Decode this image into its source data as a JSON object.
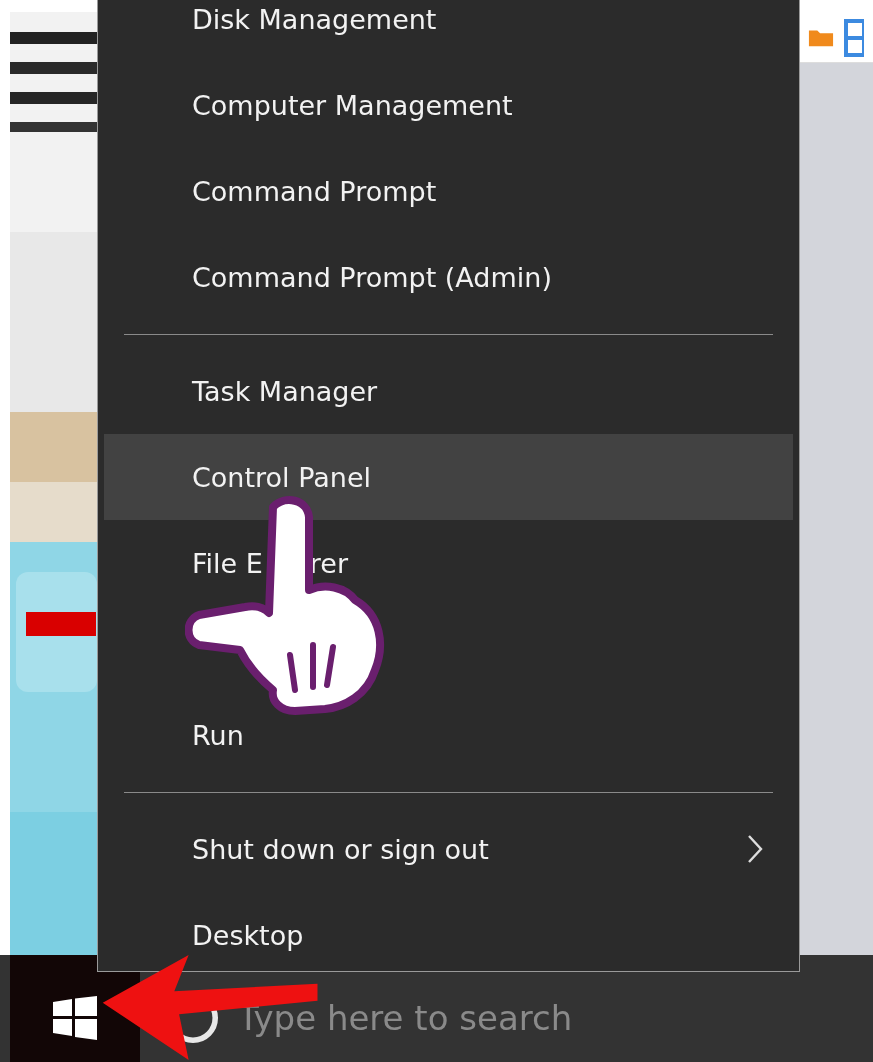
{
  "menu": {
    "items": [
      {
        "kind": "item",
        "label": "Disk Management",
        "selected": false
      },
      {
        "kind": "item",
        "label": "Computer Management",
        "selected": false
      },
      {
        "kind": "item",
        "label": "Command Prompt",
        "selected": false
      },
      {
        "kind": "item",
        "label": "Command Prompt (Admin)",
        "selected": false
      },
      {
        "kind": "divider"
      },
      {
        "kind": "item",
        "label": "Task Manager",
        "selected": false
      },
      {
        "kind": "item",
        "label": "Control Panel",
        "selected": true
      },
      {
        "kind": "item",
        "label": "File E",
        "tail": "rer",
        "selected": false
      },
      {
        "kind": "covered"
      },
      {
        "kind": "item",
        "label": "Run",
        "selected": false
      },
      {
        "kind": "divider"
      },
      {
        "kind": "submenu",
        "label": "Shut down or sign out",
        "selected": false
      },
      {
        "kind": "item",
        "label": "Desktop",
        "selected": false
      }
    ]
  },
  "taskbar": {
    "search": {
      "placeholder": "Type here to search"
    }
  }
}
